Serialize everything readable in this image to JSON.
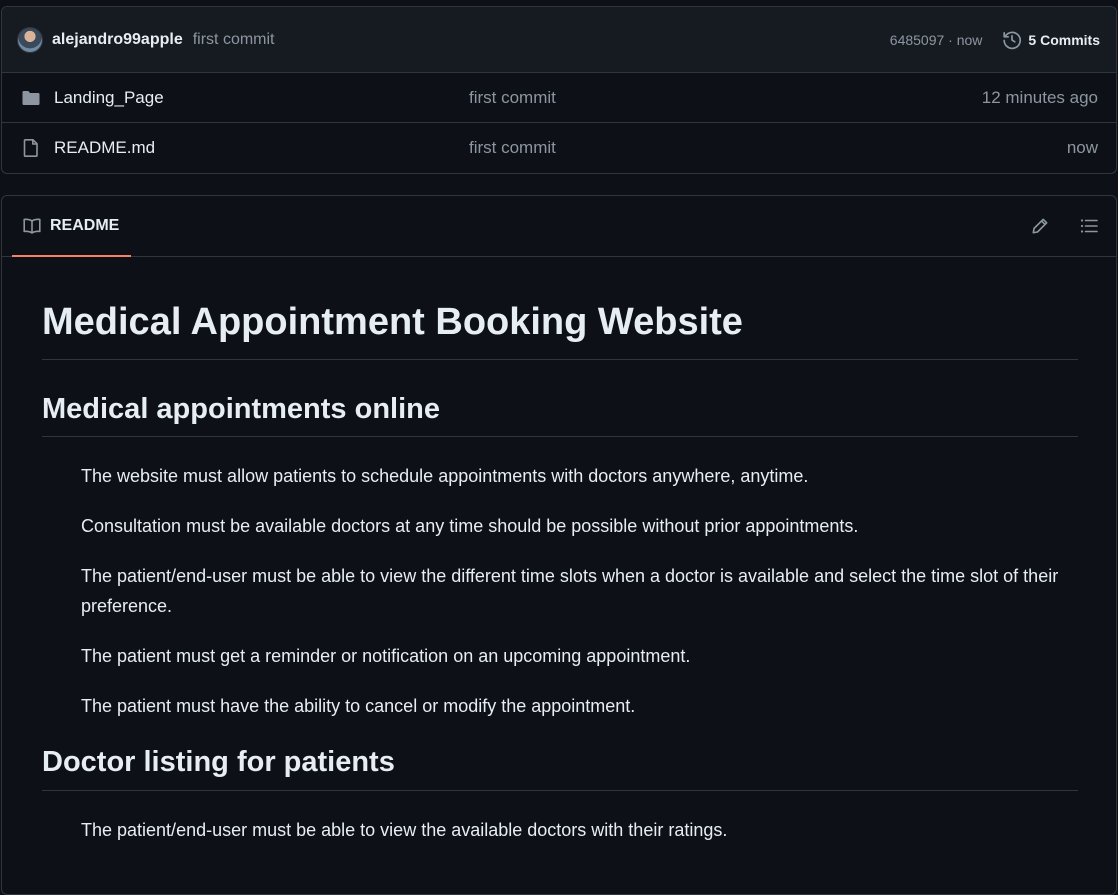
{
  "commit_bar": {
    "author": "alejandro99apple",
    "message": "first commit",
    "sha_time": "6485097 · now",
    "commits_label": "5 Commits"
  },
  "files": [
    {
      "name": "Landing_Page",
      "type": "folder",
      "message": "first commit",
      "time": "12 minutes ago"
    },
    {
      "name": "README.md",
      "type": "file",
      "message": "first commit",
      "time": "now"
    }
  ],
  "readme": {
    "tab_label": "README",
    "title": "Medical Appointment Booking Website",
    "sections": [
      {
        "heading": "Medical appointments online",
        "paragraphs": [
          "The website must allow patients to schedule appointments with doctors anywhere, anytime.",
          "Consultation must be available doctors at any time should be possible without prior appointments.",
          "The patient/end-user must be able to view the different time slots when a doctor is available and select the time slot of their preference.",
          "The patient must get a reminder or notification on an upcoming appointment.",
          "The patient must have the ability to cancel or modify the appointment."
        ]
      },
      {
        "heading": "Doctor listing for patients",
        "paragraphs": [
          "The patient/end-user must be able to view the available doctors with their ratings."
        ]
      }
    ]
  },
  "icons": {
    "folder": "folder-icon",
    "file": "file-icon",
    "history": "history-icon",
    "book": "book-icon",
    "edit": "pencil-icon",
    "outline": "list-icon"
  },
  "colors": {
    "background": "#0d1117",
    "border": "#30363d",
    "muted_text": "#8d96a0",
    "tab_underline": "#f78166"
  }
}
